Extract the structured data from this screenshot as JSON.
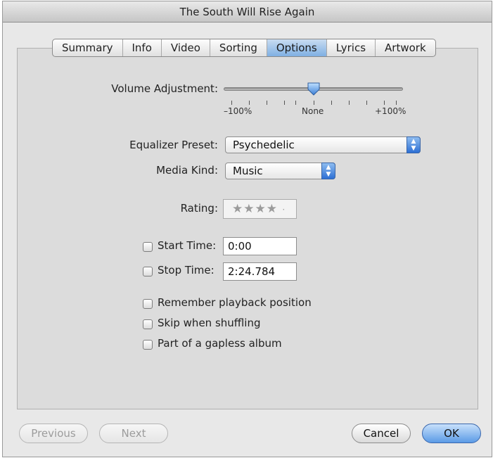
{
  "window": {
    "title": "The South Will Rise Again"
  },
  "tabs": [
    "Summary",
    "Info",
    "Video",
    "Sorting",
    "Options",
    "Lyrics",
    "Artwork"
  ],
  "active_tab": "Options",
  "volume": {
    "label": "Volume Adjustment:",
    "min_label": "–100%",
    "mid_label": "None",
    "max_label": "+100%",
    "value_percent": 0
  },
  "equalizer": {
    "label": "Equalizer Preset:",
    "value": "Psychedelic"
  },
  "media_kind": {
    "label": "Media Kind:",
    "value": "Music"
  },
  "rating": {
    "label": "Rating:",
    "stars": "★★★★",
    "dot": "·",
    "value": 4
  },
  "start_time": {
    "label": "Start Time:",
    "value": "0:00",
    "checked": false
  },
  "stop_time": {
    "label": "Stop Time:",
    "value": "2:24.784",
    "checked": false
  },
  "options": [
    {
      "label": "Remember playback position",
      "checked": false
    },
    {
      "label": "Skip when shuffling",
      "checked": false
    },
    {
      "label": "Part of a gapless album",
      "checked": false
    }
  ],
  "buttons": {
    "previous": "Previous",
    "next": "Next",
    "cancel": "Cancel",
    "ok": "OK"
  }
}
